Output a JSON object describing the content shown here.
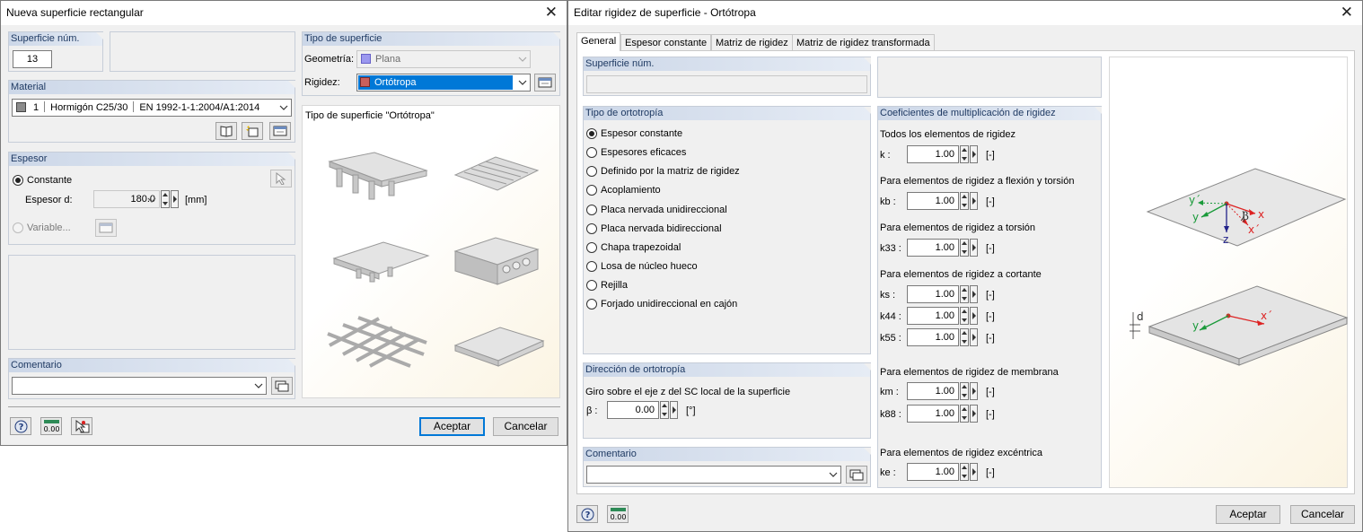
{
  "left_dialog": {
    "title": "Nueva superficie rectangular",
    "surface_no": {
      "header": "Superficie núm.",
      "value": "13"
    },
    "surface_type": {
      "header": "Tipo de superficie",
      "geometry_label": "Geometría:",
      "geometry_value": "Plana",
      "stiffness_label": "Rigidez:",
      "stiffness_value": "Ortótropa"
    },
    "material": {
      "header": "Material",
      "number": "1",
      "name": "Hormigón C25/30",
      "standard": "EN 1992-1-1:2004/A1:2014"
    },
    "thickness": {
      "header": "Espesor",
      "constant_label": "Constante",
      "thickness_label": "Espesor d:",
      "value": "180.0",
      "unit": "[mm]",
      "variable_label": "Variable..."
    },
    "preview_title": "Tipo de superficie \"Ortótropa\"",
    "comment": {
      "header": "Comentario",
      "value": ""
    },
    "ok": "Aceptar",
    "cancel": "Cancelar"
  },
  "right_dialog": {
    "title": "Editar rigidez de superficie - Ortótropa",
    "tabs": [
      {
        "label": "General"
      },
      {
        "label": "Espesor constante"
      },
      {
        "label": "Matriz de rigidez"
      },
      {
        "label": "Matriz de rigidez transformada"
      }
    ],
    "surface_no": {
      "header": "Superficie núm.",
      "value": ""
    },
    "orthotropy_type": {
      "header": "Tipo de ortotropía",
      "options": [
        {
          "label": "Espesor constante",
          "checked": true
        },
        {
          "label": "Espesores eficaces",
          "checked": false
        },
        {
          "label": "Definido por la matriz de rigidez",
          "checked": false
        },
        {
          "label": "Acoplamiento",
          "checked": false
        },
        {
          "label": "Placa nervada unidireccional",
          "checked": false
        },
        {
          "label": "Placa nervada bidireccional",
          "checked": false
        },
        {
          "label": "Chapa trapezoidal",
          "checked": false
        },
        {
          "label": "Losa de núcleo hueco",
          "checked": false
        },
        {
          "label": "Rejilla",
          "checked": false
        },
        {
          "label": "Forjado unidireccional en cajón",
          "checked": false
        }
      ]
    },
    "orthotropy_direction": {
      "header": "Dirección de ortotropía",
      "description": "Giro sobre el eje z del SC local de la superficie",
      "beta_label": "β :",
      "beta_value": "0.00",
      "unit": "[°]"
    },
    "comment": {
      "header": "Comentario",
      "value": ""
    },
    "coefficients": {
      "header": "Coeficientes de multiplicación de rigidez",
      "groups": [
        {
          "title": "Todos los elementos de rigidez",
          "rows": [
            {
              "label": "k :",
              "value": "1.00",
              "unit": "[-]"
            }
          ]
        },
        {
          "title": "Para elementos de rigidez a flexión y torsión",
          "rows": [
            {
              "label": "kb :",
              "value": "1.00",
              "unit": "[-]"
            }
          ]
        },
        {
          "title": "Para elementos de rigidez a torsión",
          "rows": [
            {
              "label": "k33 :",
              "value": "1.00",
              "unit": "[-]"
            }
          ]
        },
        {
          "title": "Para elementos de rigidez a cortante",
          "rows": [
            {
              "label": "ks :",
              "value": "1.00",
              "unit": "[-]"
            },
            {
              "label": "k44 :",
              "value": "1.00",
              "unit": "[-]"
            },
            {
              "label": "k55 :",
              "value": "1.00",
              "unit": "[-]"
            }
          ]
        },
        {
          "title": "Para elementos de rigidez de membrana",
          "rows": [
            {
              "label": "km :",
              "value": "1.00",
              "unit": "[-]"
            },
            {
              "label": "k88 :",
              "value": "1.00",
              "unit": "[-]"
            }
          ]
        },
        {
          "title": "Para elementos de rigidez excéntrica",
          "rows": [
            {
              "label": "ke :",
              "value": "1.00",
              "unit": "[-]"
            }
          ]
        }
      ]
    },
    "diagram": {
      "top_labels": {
        "y_prime": "y´",
        "y": "y",
        "beta": "β",
        "x": "x",
        "x_prime": "x´",
        "z": "z"
      },
      "bottom_labels": {
        "d": "d",
        "y_prime": "y´",
        "x_prime": "x´"
      }
    },
    "ok": "Aceptar",
    "cancel": "Cancelar"
  }
}
